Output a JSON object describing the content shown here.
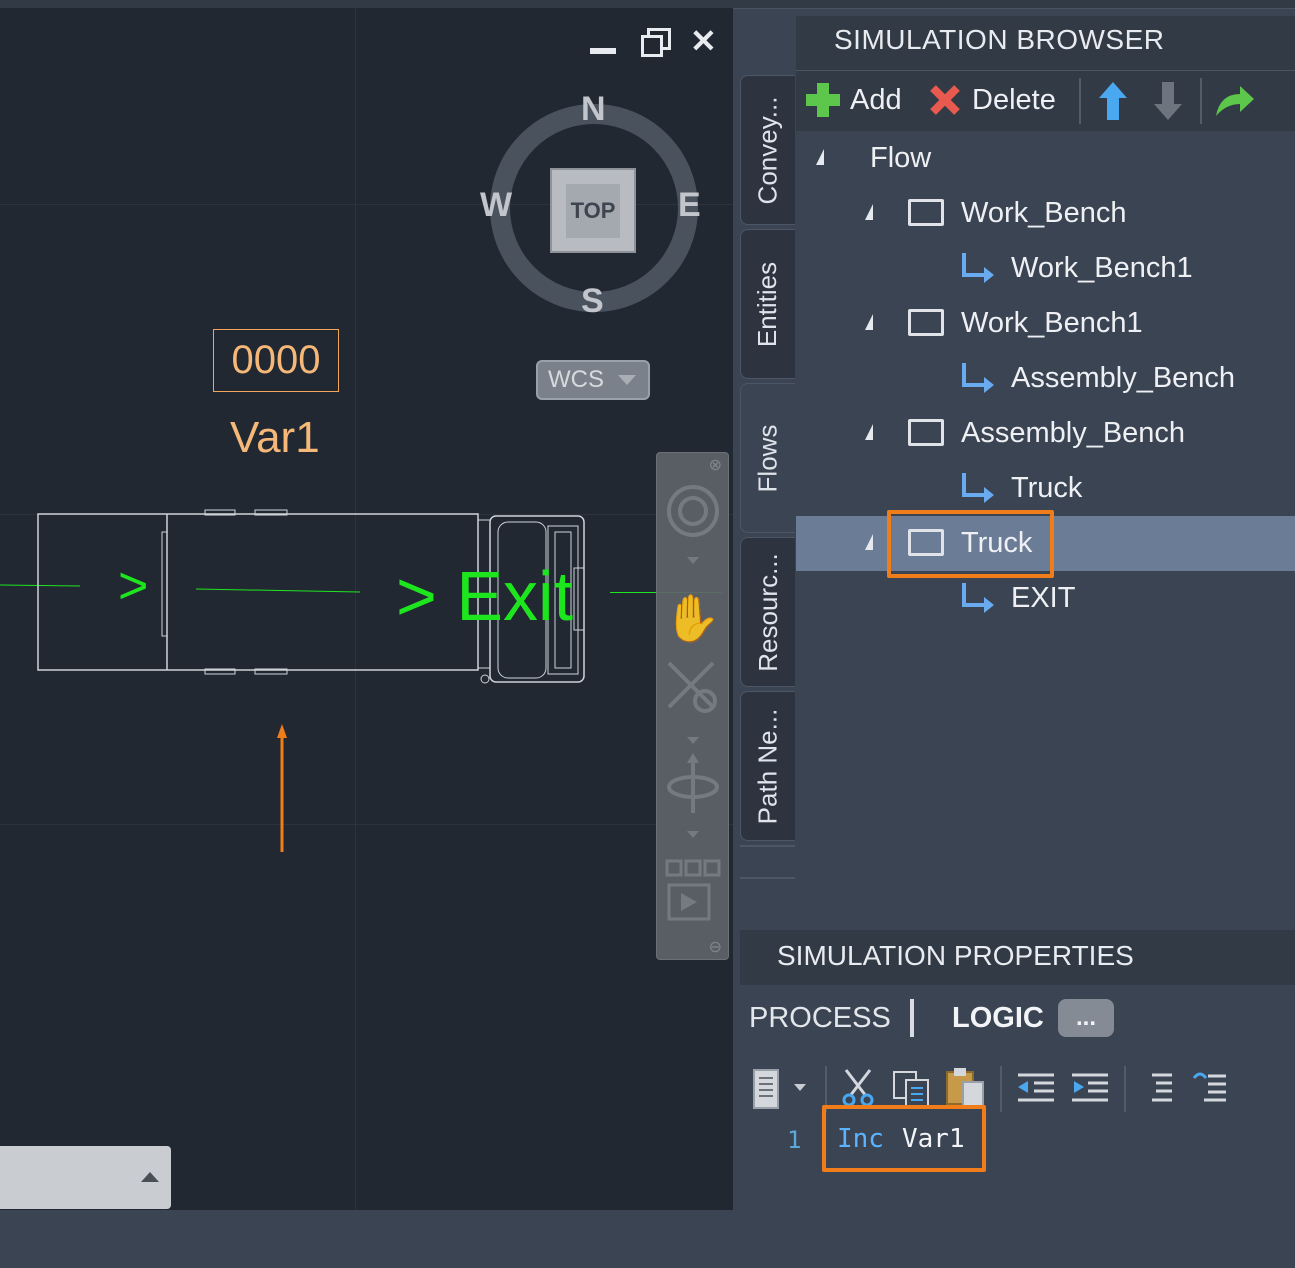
{
  "viewport": {
    "counter_value": "0000",
    "variable_label": "Var1",
    "flow_arrow_1": ">",
    "flow_arrow_2": "> Exit",
    "compass": {
      "n": "N",
      "s": "S",
      "e": "E",
      "w": "W",
      "top_face": "TOP"
    },
    "wcs_label": "WCS"
  },
  "side_tabs": [
    "Convey...",
    "Entities",
    "Flows",
    "Resourc...",
    "Path Ne..."
  ],
  "browser": {
    "title": "SIMULATION BROWSER",
    "add_label": "Add",
    "delete_label": "Delete",
    "tree": {
      "root": "Flow",
      "nodes": [
        {
          "name": "Work_Bench",
          "route": "Work_Bench1"
        },
        {
          "name": "Work_Bench1",
          "route": "Assembly_Bench"
        },
        {
          "name": "Assembly_Bench",
          "route": "Truck"
        },
        {
          "name": "Truck",
          "route": "EXIT",
          "selected": true
        }
      ]
    }
  },
  "properties": {
    "title": "SIMULATION PROPERTIES",
    "tab_process": "PROCESS",
    "tab_logic": "LOGIC",
    "more_button": "...",
    "code": {
      "line_number": "1",
      "keyword": "Inc",
      "argument": "Var1"
    }
  },
  "colors": {
    "highlight": "#f07d1a",
    "flow_green": "#1ee61e",
    "counter_orange": "#f5b878",
    "selected_row": "#6b7c97"
  }
}
